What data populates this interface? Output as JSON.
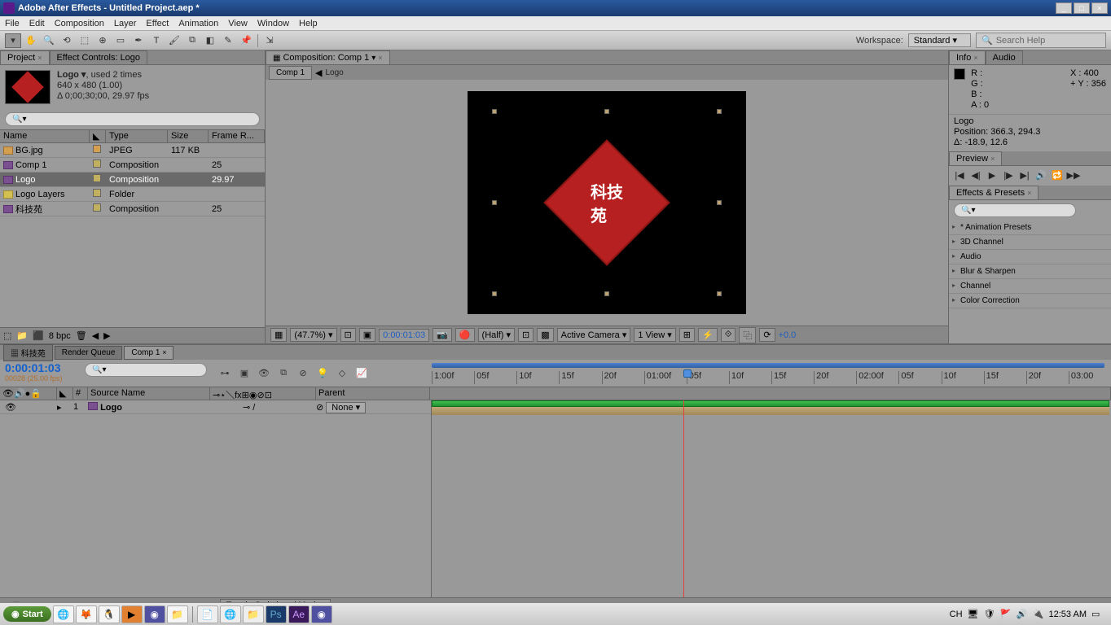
{
  "titlebar": {
    "app": "Adobe After Effects",
    "project": "Untitled Project.aep *"
  },
  "menu": [
    "File",
    "Edit",
    "Composition",
    "Layer",
    "Effect",
    "Animation",
    "View",
    "Window",
    "Help"
  ],
  "workspace": {
    "label": "Workspace:",
    "value": "Standard"
  },
  "search_help": "Search Help",
  "project_panel": {
    "tab1": "Project",
    "tab2": "Effect Controls: Logo",
    "item_name": "Logo ▾",
    "usage": ", used 2 times",
    "dims": "640 x 480 (1.00)",
    "dur": "Δ 0;00;30;00, 29.97 fps",
    "search_placeholder": "",
    "headers": {
      "name": "Name",
      "type": "Type",
      "size": "Size",
      "rate": "Frame R..."
    },
    "rows": [
      {
        "name": "BG.jpg",
        "type": "JPEG",
        "size": "117 KB",
        "rate": "",
        "icon": "img",
        "tag": "#d4a050"
      },
      {
        "name": "Comp 1",
        "type": "Composition",
        "size": "",
        "rate": "25",
        "icon": "comp",
        "tag": "#c0b060"
      },
      {
        "name": "Logo",
        "type": "Composition",
        "size": "",
        "rate": "29.97",
        "icon": "comp",
        "tag": "#c0b060",
        "selected": true
      },
      {
        "name": "Logo Layers",
        "type": "Folder",
        "size": "",
        "rate": "",
        "icon": "fold",
        "tag": "#c0b060"
      },
      {
        "name": "科技苑",
        "type": "Composition",
        "size": "",
        "rate": "25",
        "icon": "comp",
        "tag": "#c0b060"
      }
    ],
    "footer_bpc": "8 bpc"
  },
  "comp_panel": {
    "tab": "Composition: Comp 1",
    "crumb1": "Comp 1",
    "crumb2": "Logo"
  },
  "viewer_footer": {
    "zoom": "(47.7%)",
    "time": "0:00:01:03",
    "res": "(Half)",
    "camera": "Active Camera",
    "views": "1 View",
    "exposure": "+0.0"
  },
  "info_panel": {
    "tab1": "Info",
    "tab2": "Audio",
    "R": "R :",
    "G": "G :",
    "B": "B :",
    "A": "A :  0",
    "X": "X : 400",
    "Y": "Y : 356",
    "plus": "+",
    "layer": "Logo",
    "position": "Position: 366.3, 294.3",
    "delta": "Δ: -18.9, 12.6"
  },
  "preview_tab": "Preview",
  "effects_panel": {
    "tab": "Effects & Presets",
    "items": [
      "* Animation Presets",
      "3D Channel",
      "Audio",
      "Blur & Sharpen",
      "Channel",
      "Color Correction"
    ]
  },
  "timeline": {
    "tabs": [
      "科技苑",
      "Render Queue",
      "Comp 1"
    ],
    "active_tab": 2,
    "current_time": "0:00:01:03",
    "frame_info": "00028 (25.00 fps)",
    "ruler": [
      "1:00f",
      "05f",
      "10f",
      "15f",
      "20f",
      "01:00f",
      "05f",
      "10f",
      "15f",
      "20f",
      "02:00f",
      "05f",
      "10f",
      "15f",
      "20f",
      "03:00"
    ],
    "col_source": "Source Name",
    "col_parent": "Parent",
    "layer_num": "1",
    "layer_name": "Logo",
    "layer_parent": "None",
    "toggle": "Toggle Switches / Modes"
  },
  "taskbar": {
    "start": "Start",
    "lang": "CH",
    "time": "12:53 AM"
  }
}
